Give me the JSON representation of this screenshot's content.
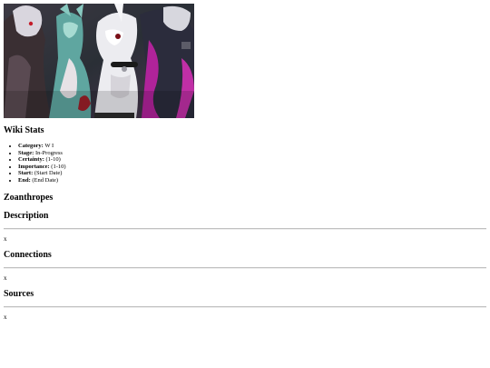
{
  "banner": {
    "icon": "character-art-image"
  },
  "wiki_stats": {
    "heading": "Wiki Stats",
    "items": [
      {
        "label": "Category:",
        "value": "W I"
      },
      {
        "label": "Stage:",
        "value": "In-Progress"
      },
      {
        "label": "Certainty:",
        "value": "(1-10)"
      },
      {
        "label": "Importance:",
        "value": "(1-10)"
      },
      {
        "label": "Start:",
        "value": "(Start Date)"
      },
      {
        "label": "End:",
        "value": "(End Date)"
      }
    ]
  },
  "page_title": "Zoanthropes",
  "sections": {
    "description": {
      "heading": "Description",
      "body": "x"
    },
    "connections": {
      "heading": "Connections",
      "body": "x"
    },
    "sources": {
      "heading": "Sources",
      "body": "x"
    }
  }
}
